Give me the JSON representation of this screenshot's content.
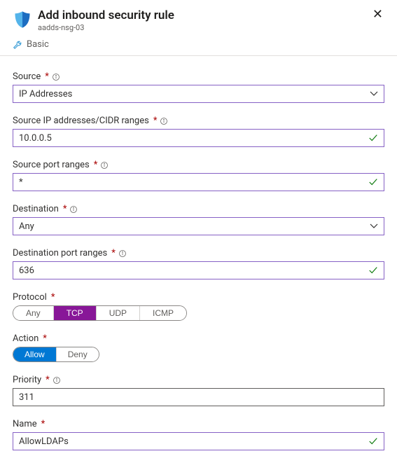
{
  "header": {
    "title": "Add inbound security rule",
    "subtitle": "aadds-nsg-03",
    "basic_link": "Basic"
  },
  "fields": {
    "source": {
      "label": "Source",
      "value": "IP Addresses"
    },
    "source_ips": {
      "label": "Source IP addresses/CIDR ranges",
      "value": "10.0.0.5"
    },
    "source_ports": {
      "label": "Source port ranges",
      "value": "*"
    },
    "destination": {
      "label": "Destination",
      "value": "Any"
    },
    "dest_ports": {
      "label": "Destination port ranges",
      "value": "636"
    },
    "protocol": {
      "label": "Protocol",
      "options": {
        "any": "Any",
        "tcp": "TCP",
        "udp": "UDP",
        "icmp": "ICMP"
      },
      "selected": "tcp"
    },
    "action": {
      "label": "Action",
      "options": {
        "allow": "Allow",
        "deny": "Deny"
      },
      "selected": "allow"
    },
    "priority": {
      "label": "Priority",
      "value": "311"
    },
    "name": {
      "label": "Name",
      "value": "AllowLDAPs"
    }
  },
  "glyphs": {
    "required": "*"
  }
}
